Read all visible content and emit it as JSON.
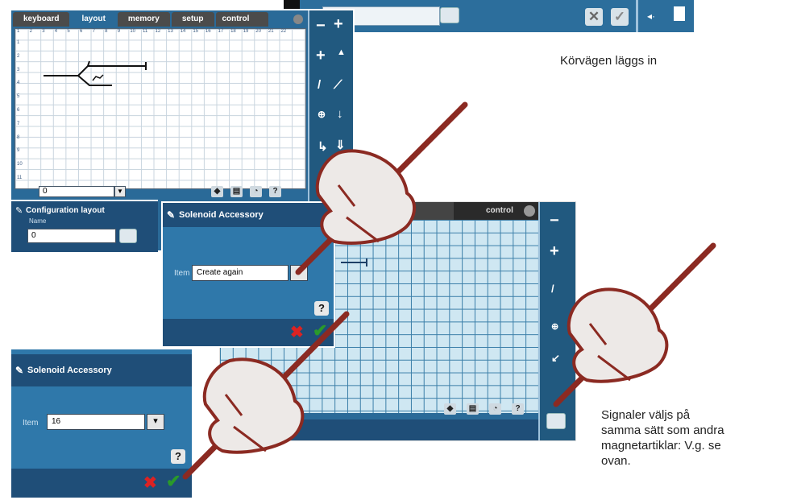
{
  "captions": {
    "top_right": "Körvägen läggs in",
    "bottom_right": [
      "Signaler väljs på",
      "samma sätt som andra",
      "magnetartiklar: V.g. se",
      "ovan."
    ]
  },
  "panel1": {
    "tabs": [
      "keyboard",
      "layout",
      "memory",
      "setup",
      "control"
    ],
    "active_tab": "layout",
    "ruler": [
      "1",
      "2",
      "3",
      "4",
      "5",
      "6",
      "7",
      "8",
      "9",
      "10",
      "11",
      "12",
      "13",
      "14",
      "15",
      "16",
      "17",
      "18",
      "19",
      "20",
      "21",
      "22"
    ],
    "rows": [
      "1",
      "2",
      "3",
      "4",
      "5",
      "6",
      "7",
      "8",
      "9",
      "10",
      "11"
    ],
    "bottom_select_value": "0",
    "config_title": "Configuration layout",
    "config_name_label": "Name",
    "config_name_value": "0",
    "tool_symbols": [
      "−",
      "+",
      "+",
      "▲",
      "/",
      "⟋",
      "⊕",
      "↓",
      "↳",
      "⇓",
      "↙"
    ]
  },
  "dialog_main": {
    "title": "Solenoid Accessory",
    "item_label": "Item",
    "item_value": "Create again",
    "help": "?"
  },
  "dialog_small": {
    "title": "Solenoid Accessory",
    "item_label": "Item",
    "item_value": "16",
    "help": "?"
  },
  "panel3": {
    "tab_control": "control",
    "help": "?"
  },
  "icons": {
    "wrench": "wrench-icon",
    "close": "close-icon",
    "confirm": "check-icon",
    "keyboard": "keyboard-icon"
  },
  "colors": {
    "panel_blue": "#2a6a98",
    "header_dark": "#1f4e78",
    "grid_light": "#cfe7f2",
    "pen_red": "#8b2a22",
    "hand_fill": "#ede9e7"
  }
}
